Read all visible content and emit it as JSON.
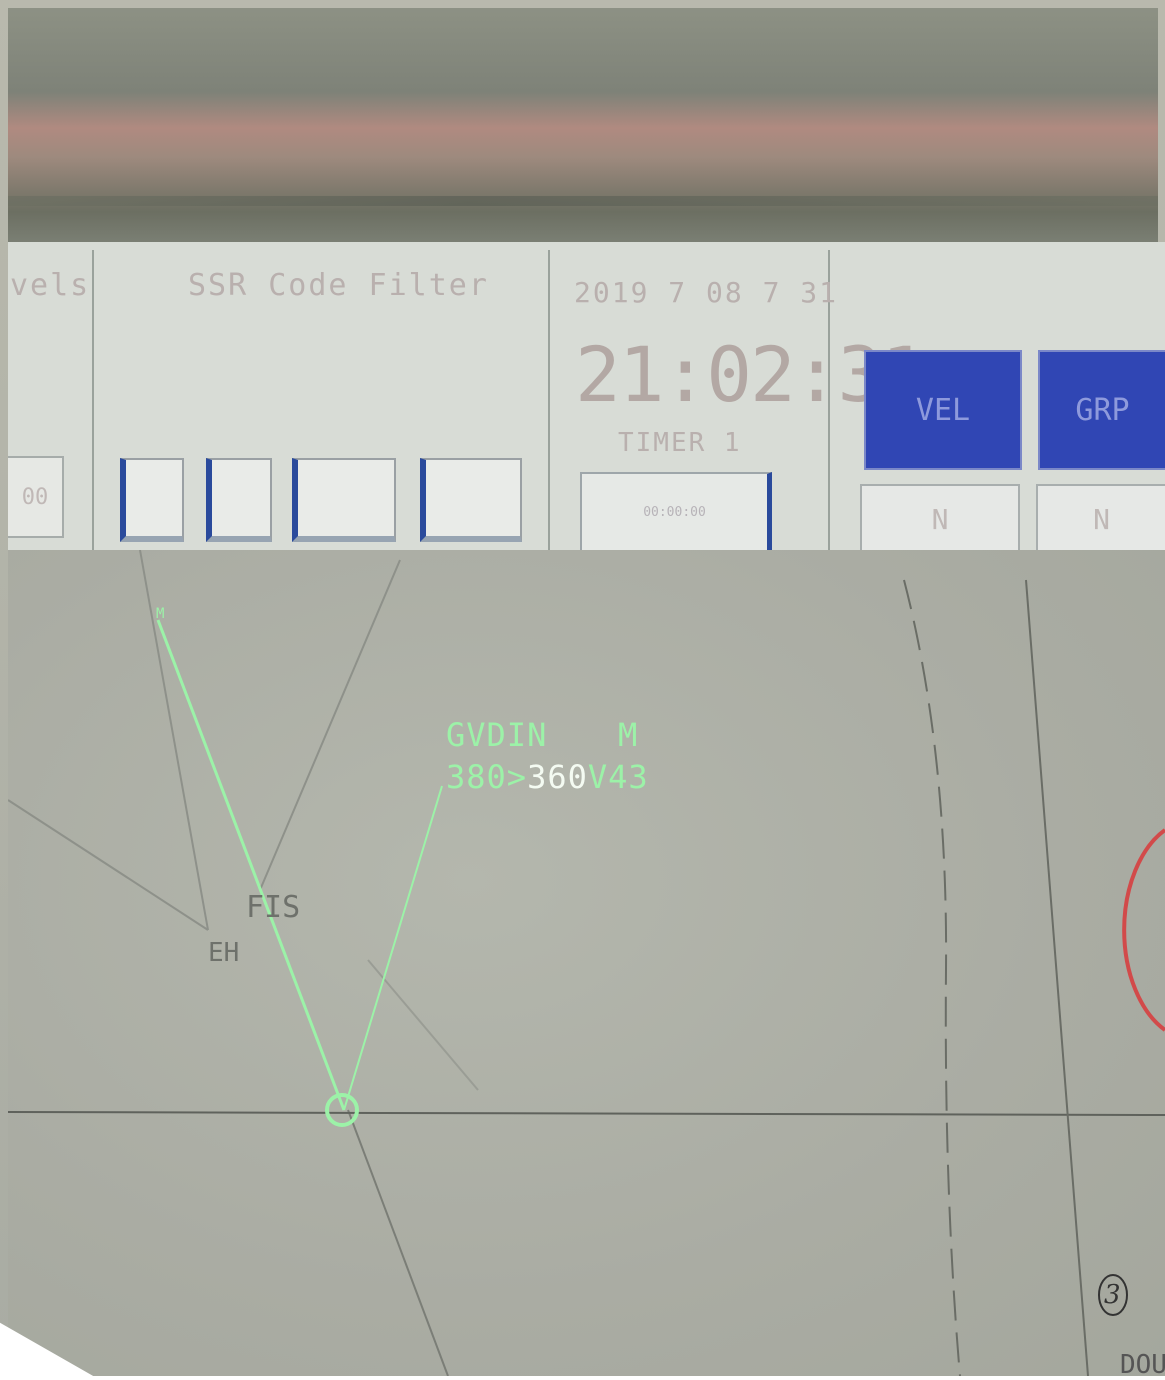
{
  "panel": {
    "left_label": "vels",
    "left_box_value": "00",
    "filter_label": "SSR Code Filter",
    "date": "2019 7 08 7 31",
    "time": "21:02:31",
    "timer_label": "TIMER 1",
    "timer_button": "00:00:00",
    "buttons": [
      {
        "label": "VEL",
        "sub": "N"
      },
      {
        "label": "GRP",
        "sub": "N"
      }
    ],
    "colors": {
      "button_blue": "#3046b4",
      "track_green": "#9cf2a8"
    }
  },
  "radar": {
    "track_top_marker": "M",
    "label_line1_callsign": "GVDIN",
    "label_line1_flag": "M",
    "label_line2_prefix": "380>",
    "label_line2_cleared": "360",
    "label_line2_speed": "V43",
    "fix_label_1": "FIS",
    "fix_label_2": "EH",
    "handwritten_mark": "3",
    "bottom_right_text": "DOU"
  }
}
